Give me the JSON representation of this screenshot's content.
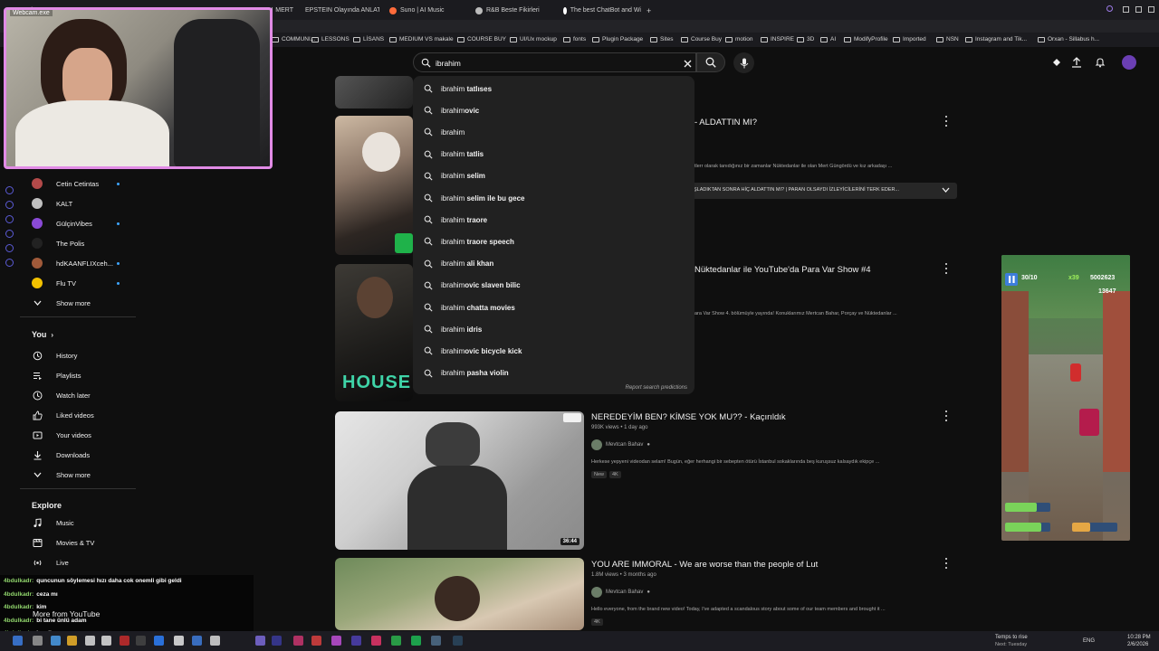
{
  "browser": {
    "tabs": [
      {
        "label": "Webcam.exe",
        "color": "#e86ad3"
      },
      {
        "label": "MERT",
        "color": "#bbbbbb"
      },
      {
        "label": "EPSTEIN Olayında ANLAT",
        "color": "#ff3b30"
      },
      {
        "label": "Suno | AI Music",
        "color": "#ff6b3b"
      },
      {
        "label": "R&B Beste Fikirleri",
        "color": "#bbbbbb"
      },
      {
        "label": "The best ChatBot and Wi",
        "color": "#ffffff"
      }
    ],
    "new_tab": "+",
    "bookmarks": [
      "COMMUNI...",
      "LESSONS",
      "LİSANS",
      "MEDIUM VS makale",
      "COURSE BUY",
      "UI/Ux mockup",
      "fonts",
      "Plugin Package",
      "Sites",
      "Course Buy",
      "motion",
      "INSPIRE",
      "3D",
      "AI",
      "ModifyProfile",
      "Imported",
      "NSN",
      "Instagram and Tik...",
      "Orxan - Sillabus h..."
    ]
  },
  "webcam": {
    "label": "Webcam.exe"
  },
  "search": {
    "value": "ibrahim",
    "placeholder": "Search",
    "suggestions": [
      {
        "prefix": "ibrahim",
        "rest": " tatlıses"
      },
      {
        "prefix": "ibrahim",
        "rest": "ovic"
      },
      {
        "prefix": "ibrahim",
        "rest": ""
      },
      {
        "prefix": "ibrahim",
        "rest": " tatlis"
      },
      {
        "prefix": "ibrahim",
        "rest": " selim"
      },
      {
        "prefix": "ibrahim",
        "rest": " selim ile bu gece"
      },
      {
        "prefix": "ibrahim",
        "rest": " traore"
      },
      {
        "prefix": "ibrahim",
        "rest": " traore speech"
      },
      {
        "prefix": "ibrahim",
        "rest": " ali khan"
      },
      {
        "prefix": "ibrahim",
        "rest": "ovic slaven bilic"
      },
      {
        "prefix": "ibrahim",
        "rest": " chatta movies"
      },
      {
        "prefix": "ibrahim",
        "rest": " idris"
      },
      {
        "prefix": "ibrahim",
        "rest": "ovic bicycle kick"
      },
      {
        "prefix": "ibrahim",
        "rest": " pasha violin"
      }
    ],
    "report": "Report search predictions"
  },
  "sidebar": {
    "subscriptions": [
      {
        "label": "Cetin Cetintas",
        "color": "#b34a4a",
        "dot": true
      },
      {
        "label": "KALT",
        "color": "#bfbfbf",
        "dot": false
      },
      {
        "label": "GülçinVibes",
        "color": "#8a4ad6",
        "dot": true
      },
      {
        "label": "The Polis",
        "color": "#222222",
        "dot": false
      },
      {
        "label": "hdKAANFLIXceh...",
        "color": "#a05a3a",
        "dot": true
      },
      {
        "label": "Flu TV",
        "color": "#f2c100",
        "dot": true
      }
    ],
    "show_more_1": "Show more",
    "you_heading": "You",
    "you_items": [
      {
        "label": "History",
        "icon": "history-icon"
      },
      {
        "label": "Playlists",
        "icon": "playlists-icon"
      },
      {
        "label": "Watch later",
        "icon": "clock-icon"
      },
      {
        "label": "Liked videos",
        "icon": "thumbs-up-icon"
      },
      {
        "label": "Your videos",
        "icon": "video-icon"
      },
      {
        "label": "Downloads",
        "icon": "download-icon"
      }
    ],
    "show_more_2": "Show more",
    "explore_heading": "Explore",
    "explore_items": [
      {
        "label": "Music",
        "icon": "music-icon"
      },
      {
        "label": "Movies & TV",
        "icon": "film-icon"
      },
      {
        "label": "Live",
        "icon": "live-icon"
      }
    ],
    "more_from": "More from YouTube"
  },
  "chat": [
    {
      "user": "4bdulkadr:",
      "msg": "quncunun söylemesi hızı daha cok onemli gibi geldi"
    },
    {
      "user": "4bdulkadr:",
      "msg": "ceza mı"
    },
    {
      "user": "4bdulkadr:",
      "msg": "kim"
    },
    {
      "user": "4bdulkadr:",
      "msg": "bi tane ünlü adam"
    },
    {
      "user": "4bdulkadr:",
      "msg": "hee ibo"
    }
  ],
  "feed": {
    "partial1": {
      "title": "- ALDATTIN MI?",
      "desc": "tlerr olarak tanıdığınız bir zamanlar Nüktedanlar ile olan Mert Güngördü ve kız arkadaşı ...",
      "chapter": "ŞLADIKTAN SONRA HİÇ ALDATTIN MI? | PARAN OLSAYDI İZLEYİCİLERİNİ TERK EDER..."
    },
    "partial2": {
      "title": "Nüktedanlar ile YouTube'da Para Var Show #4",
      "desc": "ara Var Show 4. bölümüyle yayında! Konuklarımız Mertcan Bahar, Porçay ve Nüktedanlar ...",
      "overlay_text": "HOUSE OF"
    },
    "video3": {
      "title": "NEREDEYİM BEN? KİMSE YOK MU?? - Kaçırıldık",
      "meta": "993K views • 1 day ago",
      "channel": "Mevtcan Bahav",
      "desc": "Herkese yepyeni videodan selam! Bugün, eğer herhangi bir sebepten ötürü İstanbul sokaklarında beş kuruşsuz kalsaydık ekipçe ...",
      "badges": [
        "New",
        "4K"
      ],
      "duration": "36:44"
    },
    "video4": {
      "title": "YOU ARE IMMORAL - We are worse than the people of Lut",
      "meta": "1.8M views • 3 months ago",
      "channel": "Mevtcan Bahav",
      "desc": "Hello everyone, from the brand new video! Today, I've adapted a scandalous story about some of our team members and brought it ...",
      "badges": [
        "4K"
      ]
    }
  },
  "game": {
    "score": "5002623",
    "coins": "13647",
    "timer": "30/10",
    "mult": "x39"
  },
  "taskbar": {
    "weather": "Temps to rise",
    "weather_sub": "Next: Tuesday",
    "lang": "ENG",
    "time": "10:28 PM",
    "date": "2/6/2026"
  }
}
